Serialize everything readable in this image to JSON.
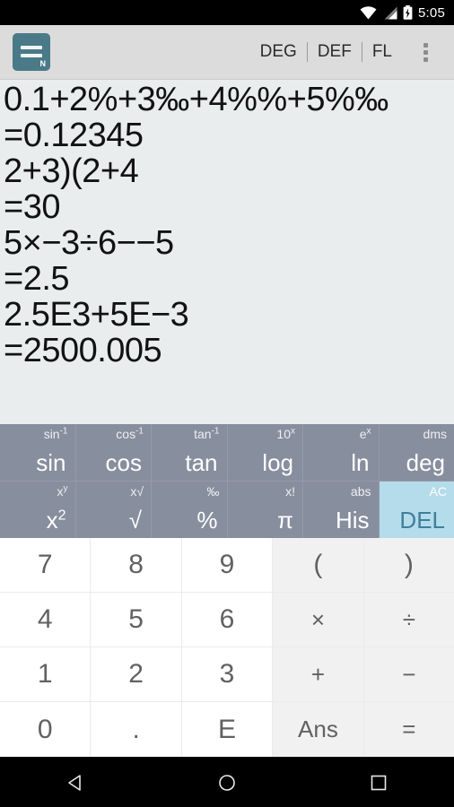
{
  "status_bar": {
    "time": "5:05",
    "icons": [
      "wifi-icon",
      "cell-signal-icon",
      "battery-charging-icon"
    ]
  },
  "app_bar": {
    "logo": {
      "name": "app-logo-icon",
      "badge": "N",
      "color": "#4a7a87"
    },
    "modes": [
      {
        "label": "DEG",
        "name": "angle-mode-button"
      },
      {
        "label": "DEF",
        "name": "notation-mode-button"
      },
      {
        "label": "FL",
        "name": "precision-mode-button"
      }
    ],
    "overflow": "overflow-menu-button"
  },
  "display": {
    "lines": [
      "0.1+2%+3‰+4%%+5%‰",
      "=0.12345",
      "2+3)(2+4",
      "=30",
      "5×−3÷6−−5",
      "=2.5",
      "2.5E3+5E−3",
      "=2500.005"
    ],
    "background": "#e9edee"
  },
  "function_keys": {
    "background": "#878e9e",
    "rows": [
      [
        {
          "sup": "sin",
          "sup_exp": "-1",
          "main": "sin",
          "name": "sin-key"
        },
        {
          "sup": "cos",
          "sup_exp": "-1",
          "main": "cos",
          "name": "cos-key"
        },
        {
          "sup": "tan",
          "sup_exp": "-1",
          "main": "tan",
          "name": "tan-key"
        },
        {
          "sup": "10",
          "sup_exp": "x",
          "main": "log",
          "name": "log-key"
        },
        {
          "sup": "e",
          "sup_exp": "x",
          "main": "ln",
          "name": "ln-key"
        },
        {
          "sup": "dms",
          "sup_exp": "",
          "main": "deg",
          "name": "deg-key"
        }
      ],
      [
        {
          "sup": "x",
          "sup_exp": "y",
          "main": "x",
          "main_exp": "2",
          "name": "square-key"
        },
        {
          "sup": "x√",
          "sup_exp": "",
          "main": "√",
          "name": "sqrt-key"
        },
        {
          "sup": "‰",
          "sup_exp": "",
          "main": "%",
          "name": "percent-key"
        },
        {
          "sup": "x!",
          "sup_exp": "",
          "main": "π",
          "name": "pi-key"
        },
        {
          "sup": "abs",
          "sup_exp": "",
          "main": "His",
          "name": "history-key"
        },
        {
          "sup": "AC",
          "sup_exp": "",
          "main": "DEL",
          "name": "delete-key",
          "highlight": true,
          "bg": "#b4dcea",
          "fg": "#3f7f9c"
        }
      ]
    ]
  },
  "number_keys": {
    "rows": [
      [
        {
          "label": "7",
          "name": "digit-7-key",
          "type": "digit"
        },
        {
          "label": "8",
          "name": "digit-8-key",
          "type": "digit"
        },
        {
          "label": "9",
          "name": "digit-9-key",
          "type": "digit"
        },
        {
          "label": "(",
          "name": "open-paren-key",
          "type": "operator"
        },
        {
          "label": ")",
          "name": "close-paren-key",
          "type": "operator"
        }
      ],
      [
        {
          "label": "4",
          "name": "digit-4-key",
          "type": "digit"
        },
        {
          "label": "5",
          "name": "digit-5-key",
          "type": "digit"
        },
        {
          "label": "6",
          "name": "digit-6-key",
          "type": "digit"
        },
        {
          "label": "×",
          "name": "multiply-key",
          "type": "operator"
        },
        {
          "label": "÷",
          "name": "divide-key",
          "type": "operator"
        }
      ],
      [
        {
          "label": "1",
          "name": "digit-1-key",
          "type": "digit"
        },
        {
          "label": "2",
          "name": "digit-2-key",
          "type": "digit"
        },
        {
          "label": "3",
          "name": "digit-3-key",
          "type": "digit"
        },
        {
          "label": "+",
          "name": "plus-key",
          "type": "operator"
        },
        {
          "label": "−",
          "name": "minus-key",
          "type": "operator"
        }
      ],
      [
        {
          "label": "0",
          "name": "digit-0-key",
          "type": "digit"
        },
        {
          "label": ".",
          "name": "decimal-point-key",
          "type": "digit"
        },
        {
          "label": "E",
          "name": "exponent-key",
          "type": "digit"
        },
        {
          "label": "Ans",
          "name": "answer-key",
          "type": "operator"
        },
        {
          "label": "=",
          "name": "equals-key",
          "type": "operator"
        }
      ]
    ]
  },
  "nav_bar": {
    "buttons": [
      {
        "name": "back-nav-icon"
      },
      {
        "name": "home-nav-icon"
      },
      {
        "name": "recents-nav-icon"
      }
    ]
  }
}
